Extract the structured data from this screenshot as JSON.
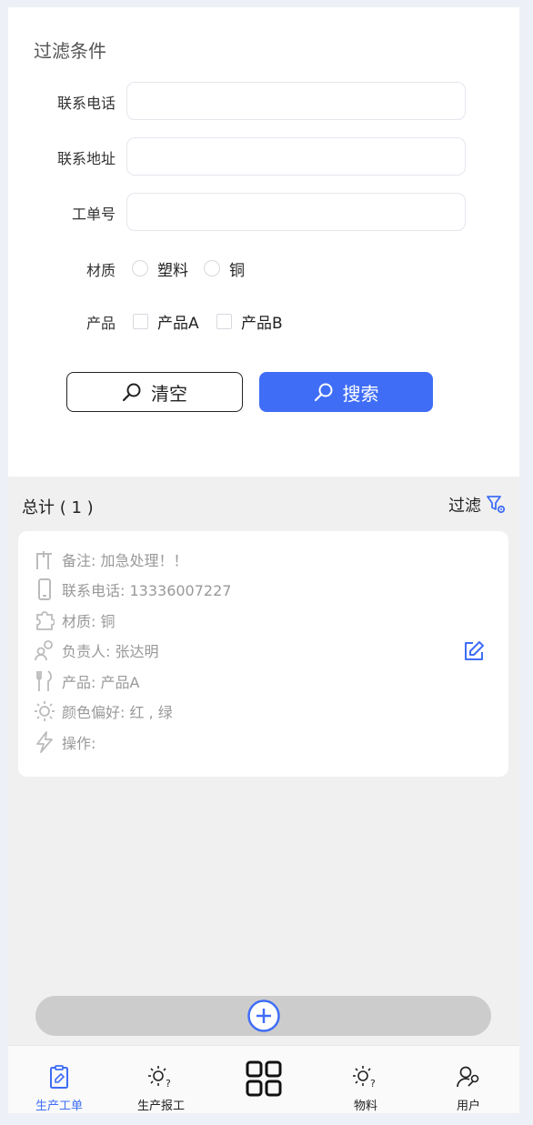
{
  "filter": {
    "title": "过滤条件",
    "fields": [
      {
        "label": "联系电话",
        "value": "",
        "placeholder": ""
      },
      {
        "label": "联系地址",
        "value": "",
        "placeholder": ""
      },
      {
        "label": "工单号",
        "value": "",
        "placeholder": ""
      }
    ],
    "material": {
      "label": "材质",
      "options": [
        "塑料",
        "铜"
      ]
    },
    "product": {
      "label": "产品",
      "options": [
        "产品A",
        "产品B"
      ]
    },
    "clear_label": "清空",
    "search_label": "搜索"
  },
  "summary": {
    "total_text": "总计 ( 1 )",
    "filter_label": "过滤"
  },
  "card": {
    "remark": "备注: 加急处理！！",
    "phone": "联系电话: 13336007227",
    "material": "材质: 铜",
    "owner": "负责人: 张达明",
    "product": "产品: 产品A",
    "color_pref": "颜色偏好: 红 , 绿",
    "action": "操作:"
  },
  "tabs": [
    {
      "label": "生产工单",
      "icon": "clipboard-edit-icon",
      "active": true
    },
    {
      "label": "生产报工",
      "icon": "sun-question-icon",
      "active": false
    },
    {
      "label": "",
      "icon": "grid-icon",
      "active": false
    },
    {
      "label": "物料",
      "icon": "sun-question-icon",
      "active": false
    },
    {
      "label": "用户",
      "icon": "user-key-icon",
      "active": false
    }
  ],
  "colors": {
    "accent": "#3f6df6",
    "muted": "#999999",
    "background": "#f0f0f0"
  }
}
